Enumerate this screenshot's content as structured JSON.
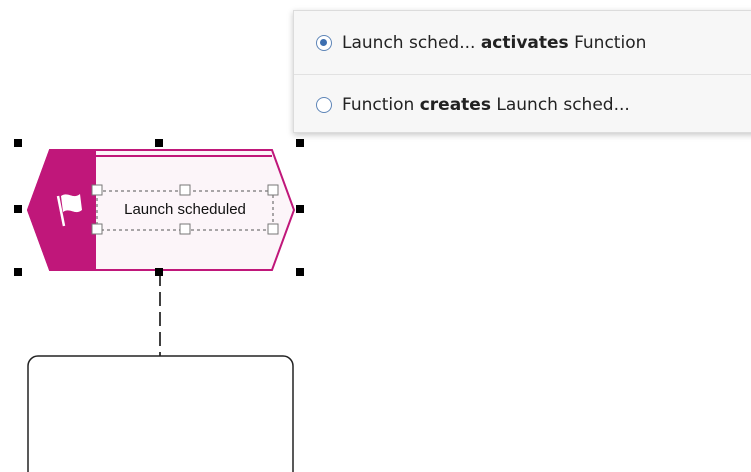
{
  "popup": {
    "options": [
      {
        "prefix": "Launch sched...",
        "verb": "activates",
        "suffix": "Function",
        "checked": true
      },
      {
        "prefix": "Function",
        "verb": "creates",
        "suffix": "Launch sched...",
        "checked": false
      }
    ]
  },
  "diagram": {
    "event": {
      "label": "Launch scheduled",
      "icon": "flag-icon",
      "color": "#c0177a"
    }
  }
}
